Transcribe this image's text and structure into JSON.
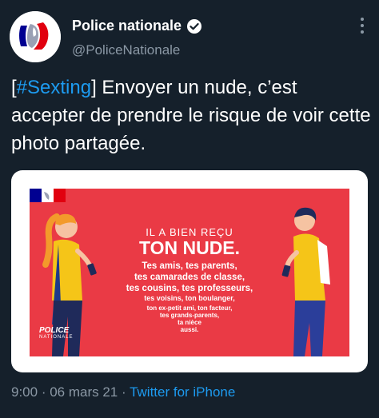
{
  "account": {
    "name": "Police nationale",
    "handle": "@PoliceNationale",
    "verified_icon": "verified-badge-icon",
    "avatar_icon": "marianne-logo"
  },
  "tweet": {
    "hashtag": "#Sexting",
    "open_bracket": "[",
    "close_bracket": "]",
    "text": " Envoyer un nude, c’est accepter de prendre le risque de voir cette photo partagée."
  },
  "poster": {
    "line1": "IL A BIEN REÇU",
    "line2": "TON NUDE.",
    "line3": "Tes amis, tes parents,",
    "line4": "tes camarades de classe,",
    "line5": "tes cousins, tes professeurs,",
    "line6": "tes voisins, ton boulanger,",
    "line7": "ton ex-petit ami, ton facteur,",
    "line8": "tes grands-parents,",
    "line9": "ta nièce",
    "line10": "aussi.",
    "logo_title": "POLICE",
    "logo_subtitle": "NATIONALE"
  },
  "footer": {
    "time": "9:00",
    "separator1": " · ",
    "date": "06 mars 21",
    "separator2": " · ",
    "source": "Twitter for iPhone"
  },
  "colors": {
    "background": "#15202b",
    "link": "#1d9bf0",
    "muted": "#8b98a5",
    "poster_red": "#ea3a45"
  }
}
